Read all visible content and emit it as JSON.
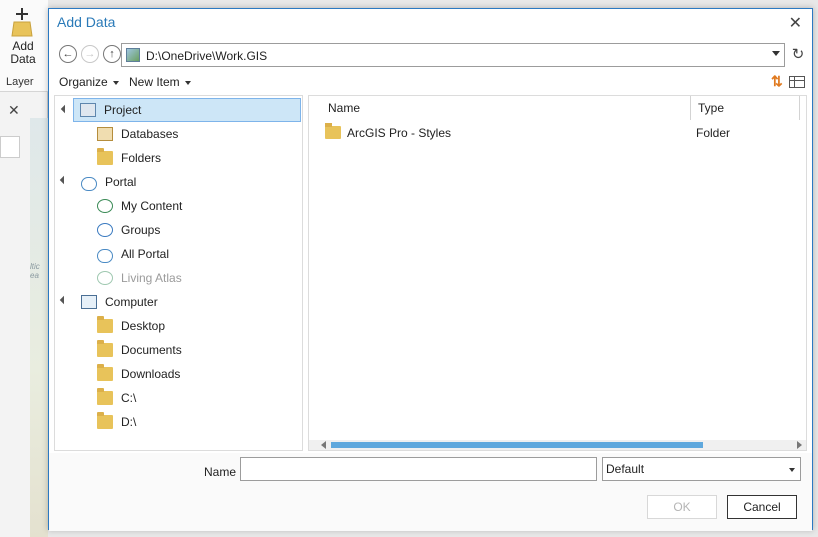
{
  "background": {
    "add_data_line1": "Add",
    "add_data_line2": "Data",
    "layer_group": "Layer",
    "map_text": "ltic\nea"
  },
  "dialog": {
    "title": "Add Data",
    "address": "D:\\OneDrive\\Work.GIS",
    "toolbar": {
      "organize": "Organize",
      "new_item": "New Item"
    },
    "tree": {
      "project": "Project",
      "databases": "Databases",
      "folders": "Folders",
      "portal": "Portal",
      "my_content": "My Content",
      "groups": "Groups",
      "all_portal": "All Portal",
      "living_atlas": "Living Atlas",
      "computer": "Computer",
      "desktop": "Desktop",
      "documents": "Documents",
      "downloads": "Downloads",
      "c_drive": "C:\\",
      "d_drive": "D:\\"
    },
    "list": {
      "col_name": "Name",
      "col_type": "Type",
      "rows": [
        {
          "name": "ArcGIS Pro - Styles",
          "type": "Folder"
        }
      ]
    },
    "name_label": "Name",
    "name_value": "",
    "filter_value": "Default",
    "ok": "OK",
    "cancel": "Cancel"
  },
  "colors": {
    "title": "#2a7ab8",
    "selection": "#cde6f7",
    "scroll_thumb": "#5fa8dd",
    "folder": "#e8c35a"
  }
}
